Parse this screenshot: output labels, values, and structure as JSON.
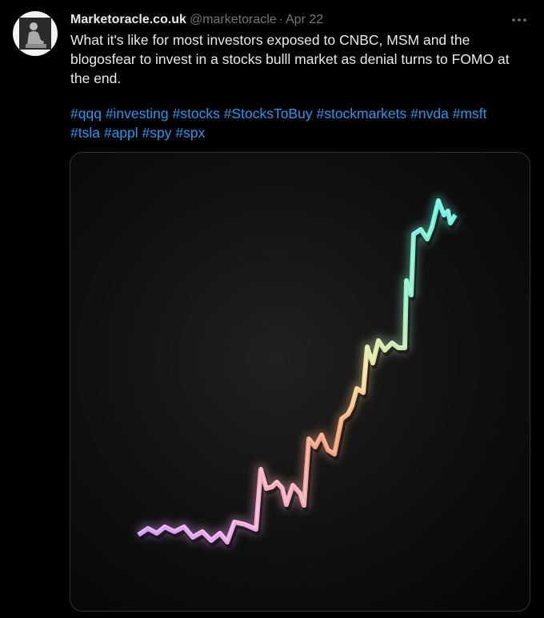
{
  "tweet": {
    "display_name": "Marketoracle.co.uk",
    "handle": "@marketoracle",
    "separator": "·",
    "date": "Apr 22",
    "more_icon": "more-horizontal-icon",
    "text": "What it's like for most investors exposed to CNBC, MSM and the blogosfear to invest in a stocks bulll market as denial turns to FOMO at the end.",
    "hashtags": [
      "#qqq",
      "#investing",
      "#stocks",
      "#StocksToBuy",
      "#stockmarkets",
      "#nvda",
      "#msft",
      "#tsla",
      "#appl",
      "#spy",
      "#spx"
    ]
  },
  "media": {
    "description_icon": "rising-stock-line-image",
    "gradient_colors": [
      "#d79cff",
      "#f7b0d8",
      "#f2a070",
      "#f4e4a0",
      "#8ef0c6",
      "#67f0e8"
    ]
  }
}
